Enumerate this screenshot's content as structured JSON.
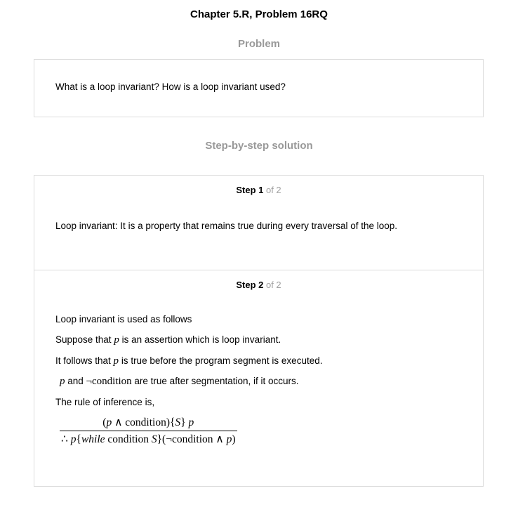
{
  "header": {
    "chapter_title": "Chapter 5.R, Problem 16RQ"
  },
  "problem": {
    "heading": "Problem",
    "text": "What is a loop invariant? How is a loop invariant used?"
  },
  "solution": {
    "heading": "Step-by-step solution",
    "steps": [
      {
        "step_word": "Step 1",
        "of_total": " of 2",
        "lines": [
          "Loop invariant: It is a property that remains true during every traversal of the loop."
        ]
      },
      {
        "step_word": "Step 2",
        "of_total": " of 2",
        "line1": "Loop invariant is used as follows",
        "line2_pre": "Suppose that ",
        "line2_var": "p",
        "line2_post": " is an assertion which is loop invariant.",
        "line3_pre": "It follows that ",
        "line3_var": "p",
        "line3_post": " is true before the program segment is executed.",
        "line4_var": "p",
        "line4_and": " and ",
        "line4_neg": "¬condition",
        "line4_post": " are true after segmentation, if it occurs.",
        "line5": "The rule of inference is,",
        "formula": {
          "numerator_open": "(",
          "numerator_p": "p",
          "numerator_mid": " ∧ condition){",
          "numerator_S": "S",
          "numerator_close": "} ",
          "numerator_p2": "p",
          "denom_therefore": "∴ ",
          "denom_p": "p",
          "denom_brace_open": "{",
          "denom_while": "while",
          "denom_condition": " condition ",
          "denom_S": "S",
          "denom_rest": "}(¬condition ∧ ",
          "denom_p2": "p",
          "denom_close": ")"
        }
      }
    ]
  }
}
